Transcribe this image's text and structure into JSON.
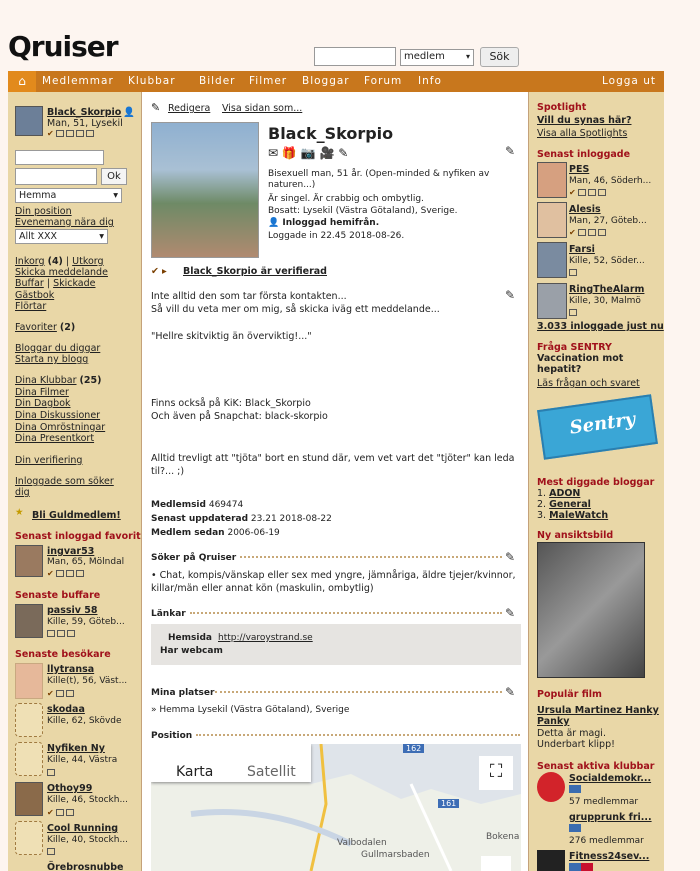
{
  "logo": "Qruiser",
  "search": {
    "placeholder": "",
    "select": "medlem",
    "button": "Sök"
  },
  "nav": {
    "items": [
      "Medlemmar",
      "Klubbar",
      "Bilder",
      "Filmer",
      "Bloggar",
      "Forum",
      "Info"
    ],
    "logout": "Logga ut"
  },
  "left": {
    "user": {
      "name": "Black_Skorpio",
      "info": "Man, 51, Lysekil"
    },
    "ok": "Ok",
    "region": "Hemma",
    "links1": [
      "Din position",
      "Evenemang nära dig"
    ],
    "allt": "Allt XXX",
    "inkorg": "Inkorg",
    "inkorg_n": "(4)",
    "utkorg": "Utkorg",
    "skicka": "Skicka meddelande",
    "buffar": "Buffar",
    "skickade": "Skickade",
    "gastbok": "Gästbok",
    "flortar": "Flörtar",
    "favoriter": "Favoriter",
    "fav_n": "(2)",
    "bloggar": "Bloggar du diggar",
    "starta": "Starta ny blogg",
    "klubbar": "Dina Klubbar",
    "klubbar_n": "(25)",
    "list2": [
      "Dina Filmer",
      "Din Dagbok",
      "Dina Diskussioner",
      "Dina Omröstningar",
      "Dina Presentkort"
    ],
    "verif": "Din verifiering",
    "soker": "Inloggade som söker dig",
    "guld": "Bli Guldmedlem!",
    "fav_head": "Senast inloggad favorit",
    "fav": {
      "name": "ingvar53",
      "info": "Man, 65, Mölndal"
    },
    "buff_head": "Senaste buffare",
    "buff": {
      "name": "passiv 58",
      "info": "Kille, 59, Göteb..."
    },
    "bes_head": "Senaste besökare",
    "besok": [
      {
        "name": "llytransa",
        "info": "Kille(t), 56, Väst..."
      },
      {
        "name": "skodaa",
        "info": "Kille, 62, Skövde"
      },
      {
        "name": "Nyfiken Ny",
        "info": "Kille, 44, Västra"
      },
      {
        "name": "Othoy99",
        "info": "Kille, 46, Stockh..."
      },
      {
        "name": "Cool Running",
        "info": "Kille, 40, Stockh..."
      },
      {
        "name": "Örebrosnubbe",
        "info": ""
      }
    ]
  },
  "main": {
    "redigera": "Redigera",
    "visa": "Visa sidan som...",
    "name": "Black_Skorpio",
    "bio": [
      "Bisexuell man, 51 år. (Open-minded & nyfiken av naturen...)",
      "Är singel. Är crabbig och ombytlig.",
      "Bosatt: Lysekil (Västra Götaland), Sverige.",
      "Inloggad hemifrån.",
      "Loggade in 22.45 2018-08-26."
    ],
    "verified": "Black_Skorpio är verifierad",
    "pres": [
      "Inte alltid den som tar första kontakten...",
      "Så vill du veta mer om mig, så skicka iväg ett meddelande...",
      "\"Hellre skitviktig än överviktig!...\"",
      "Finns också på KiK: Black_Skorpio",
      "Och även på Snapchat: black-skorpio",
      "Alltid trevligt att \"tjöta\" bort en stund där, vem vet vart det \"tjöter\" kan leda til?... ;)"
    ],
    "meta": [
      {
        "k": "Medlemsid",
        "v": "469474"
      },
      {
        "k": "Senast uppdaterad",
        "v": "23.21 2018-08-22"
      },
      {
        "k": "Medlem sedan",
        "v": "2006-06-19"
      }
    ],
    "soker_head": "Söker på Qruiser",
    "soker": "• Chat, kompis/vänskap eller sex med yngre, jämnåriga, äldre tjejer/kvinnor, killar/män eller annat kön (maskulin, ombytlig)",
    "lankar_head": "Länkar",
    "hemsida": "Hemsida",
    "url": "http://varoystrand.se",
    "webcam": "Har webcam",
    "platser_head": "Mina platser",
    "plats": "» Hemma Lysekil (Västra Götaland), Sverige",
    "position_head": "Position",
    "map": {
      "karta": "Karta",
      "satellit": "Satellit",
      "r162": "162",
      "r161": "161",
      "valbo": "Valbodalen",
      "gull": "Gullmarsbaden",
      "bokena": "Bokena"
    }
  },
  "right": {
    "spot_head": "Spotlight",
    "spot_q": "Vill du synas här?",
    "spot_all": "Visa alla Spotlights",
    "log_head": "Senast inloggade",
    "users": [
      {
        "name": "PES",
        "info": "Man, 46, Söderh..."
      },
      {
        "name": "Alesis",
        "info": "Man, 27, Göteb..."
      },
      {
        "name": "Farsi",
        "info": "Kille, 52, Söder..."
      },
      {
        "name": "RingTheAlarm",
        "info": "Kille, 30, Malmö"
      }
    ],
    "online": "3.033 inloggade just nu",
    "sentry_head": "Fråga SENTRY",
    "sentry_q": "Vaccination mot hepatit?",
    "sentry_link": "Läs frågan och svaret",
    "sentry_logo": "Sentry",
    "blog_head": "Mest diggade bloggar",
    "blogs": [
      "ADON",
      "General",
      "MaleWatch"
    ],
    "face_head": "Ny ansiktsbild",
    "film_head": "Populär film",
    "film_name": "Ursula Martinez Hanky Panky",
    "film_desc": "Detta är magi. Underbart klipp!",
    "club_head": "Senast aktiva klubbar",
    "clubs": [
      {
        "name": "Socialdemokr...",
        "info": "57 medlemmar"
      },
      {
        "name": "grupprunk fri...",
        "info": "276 medlemmar"
      },
      {
        "name": "Fitness24sev...",
        "info": ""
      }
    ]
  }
}
